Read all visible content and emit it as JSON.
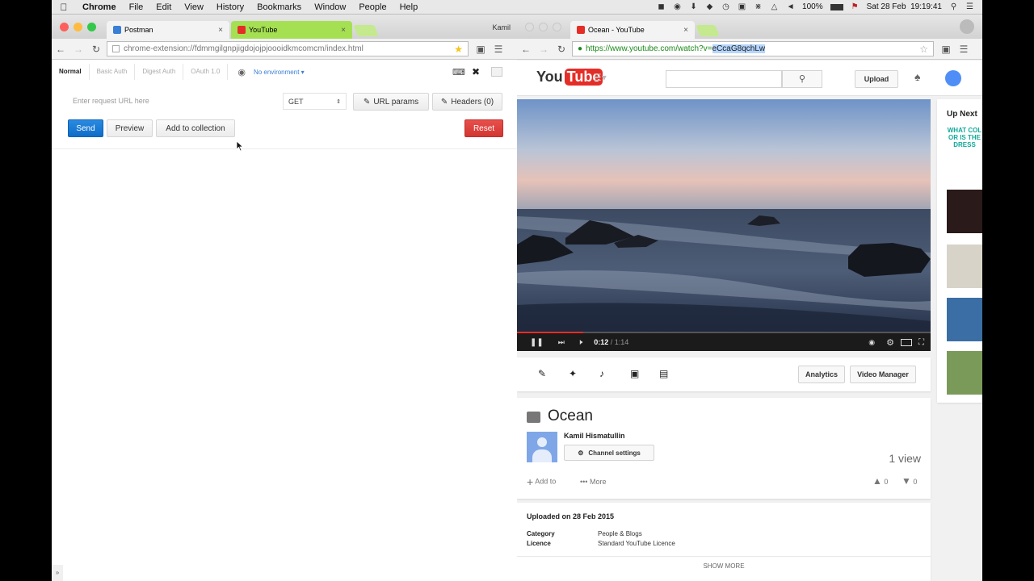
{
  "menubar": {
    "app": "Chrome",
    "items": [
      "File",
      "Edit",
      "View",
      "History",
      "Bookmarks",
      "Window",
      "People",
      "Help"
    ],
    "battery": "100%",
    "datetime": "Sat 28 Feb  19:19:41"
  },
  "left_window": {
    "tabs": [
      {
        "title": "Postman",
        "favicon_color": "#3a7fd5"
      },
      {
        "title": "YouTube",
        "favicon_color": "#e52d27"
      }
    ],
    "profile": "Kamil",
    "url": "chrome-extension://fdmmgilgnpjigdojojpjoooidkmcomcm/index.html",
    "postman": {
      "tabs": [
        "Normal",
        "Basic Auth",
        "Digest Auth",
        "OAuth 1.0"
      ],
      "environment": "No environment",
      "url_placeholder": "Enter request URL here",
      "method": "GET",
      "url_params_label": "URL params",
      "headers_label": "Headers (0)",
      "send_label": "Send",
      "preview_label": "Preview",
      "add_collection_label": "Add to collection",
      "reset_label": "Reset"
    }
  },
  "right_window": {
    "tabs": [
      {
        "title": "Ocean - YouTube",
        "favicon_color": "#e52d27"
      }
    ],
    "url_prefix": "https://www.youtube.com/watch?v=",
    "url_selected": "eCcaG8qchLw",
    "youtube": {
      "logo_you": "You",
      "logo_tube": "Tube",
      "upload_label": "Upload",
      "video": {
        "current_time": "0:12",
        "duration": "1:14",
        "progress": 0.16
      },
      "tool_buttons": {
        "analytics": "Analytics",
        "video_manager": "Video Manager"
      },
      "title": "Ocean",
      "channel": "Kamil Hismatullin",
      "channel_settings_label": "Channel settings",
      "views": "1 view",
      "add_to_label": "Add to",
      "more_label": "More",
      "likes": "0",
      "dislikes": "0",
      "upload_date": "Uploaded on 28 Feb 2015",
      "meta": [
        {
          "key": "Category",
          "value": "People & Blogs"
        },
        {
          "key": "Licence",
          "value": "Standard YouTube Licence"
        }
      ],
      "show_more_label": "SHOW MORE",
      "up_next_label": "Up Next",
      "up_next_first_text": "WHAT COLOR IS THE DRESS"
    }
  }
}
